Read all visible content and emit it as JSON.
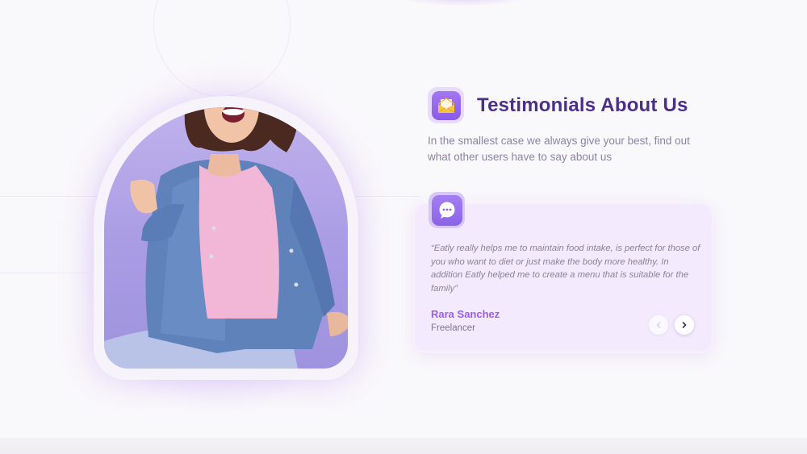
{
  "section": {
    "title": "Testimonials About Us",
    "subtitle": "In the smallest case we always give your best, find out what other users have to say about us"
  },
  "testimonial": {
    "quote": "“Eatly really helps me to maintain food intake, is perfect for those of you who want to diet or just make the body more healthy. In addition Eatly helped me to create a menu that is suitable for the family”",
    "author_name": "Rara Sanchez",
    "author_role": "Freelancer"
  },
  "icons": {
    "title_icon": "envelope-icon",
    "quote_icon": "chat-bubble-icon",
    "prev": "chevron-left-icon",
    "next": "chevron-right-icon"
  },
  "colors": {
    "accent": "#8a5be8",
    "title": "#4c2f86",
    "card_bg": "#f3eafd",
    "author_name": "#9a5fe6"
  }
}
